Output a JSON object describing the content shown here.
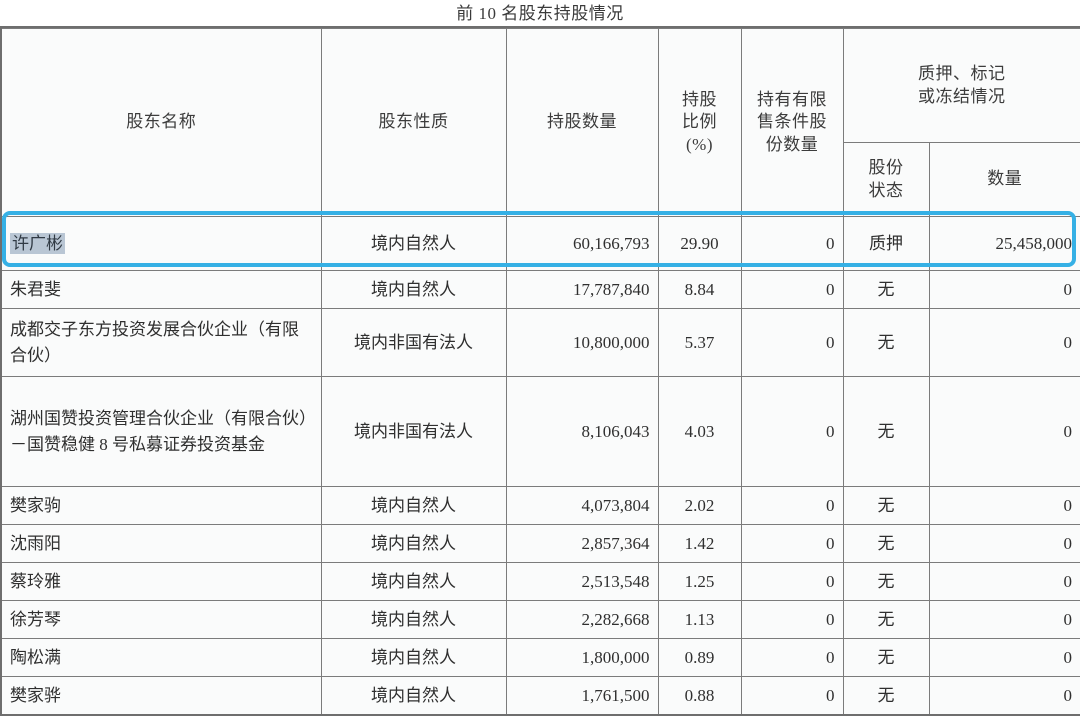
{
  "document": {
    "title": "前 10 名股东持股情况"
  },
  "colors": {
    "highlight_border": "#35b0e5",
    "text_selection_bg": "#b9c6d4",
    "table_border": "#7b7b7b",
    "cell_background": "#fafbfb"
  },
  "table": {
    "headers": {
      "name": "股东名称",
      "nature": "股东性质",
      "shares": "持股数量",
      "ratio": "持股比例（%）",
      "ratio_line1": "持股",
      "ratio_line2": "比例",
      "ratio_line3": "(%)",
      "restricted": "持有有限售条件股份数量",
      "pledge_group": "质押、标记或冻结情况",
      "pledge_group_line1": "质押、标记",
      "pledge_group_line2": "或冻结情况",
      "share_state": "股份状态",
      "share_state_line1": "股份",
      "share_state_line2": "状态",
      "quantity": "数量"
    },
    "rows": [
      {
        "name": "许广彬",
        "nature": "境内自然人",
        "shares": "60,166,793",
        "ratio": "29.90",
        "restricted": "0",
        "state": "质押",
        "quantity": "25,458,000",
        "highlighted": true,
        "selected_text": true
      },
      {
        "name": "朱君斐",
        "nature": "境内自然人",
        "shares": "17,787,840",
        "ratio": "8.84",
        "restricted": "0",
        "state": "无",
        "quantity": "0",
        "highlighted": false,
        "selected_text": false
      },
      {
        "name": "成都交子东方投资发展合伙企业（有限合伙）",
        "nature": "境内非国有法人",
        "shares": "10,800,000",
        "ratio": "5.37",
        "restricted": "0",
        "state": "无",
        "quantity": "0",
        "highlighted": false,
        "selected_text": false
      },
      {
        "name": "湖州国赞投资管理合伙企业（有限合伙）－国赞稳健 8 号私募证券投资基金",
        "nature": "境内非国有法人",
        "shares": "8,106,043",
        "ratio": "4.03",
        "restricted": "0",
        "state": "无",
        "quantity": "0",
        "highlighted": false,
        "selected_text": false
      },
      {
        "name": "樊家驹",
        "nature": "境内自然人",
        "shares": "4,073,804",
        "ratio": "2.02",
        "restricted": "0",
        "state": "无",
        "quantity": "0",
        "highlighted": false,
        "selected_text": false
      },
      {
        "name": "沈雨阳",
        "nature": "境内自然人",
        "shares": "2,857,364",
        "ratio": "1.42",
        "restricted": "0",
        "state": "无",
        "quantity": "0",
        "highlighted": false,
        "selected_text": false
      },
      {
        "name": "蔡玲雅",
        "nature": "境内自然人",
        "shares": "2,513,548",
        "ratio": "1.25",
        "restricted": "0",
        "state": "无",
        "quantity": "0",
        "highlighted": false,
        "selected_text": false
      },
      {
        "name": "徐芳琴",
        "nature": "境内自然人",
        "shares": "2,282,668",
        "ratio": "1.13",
        "restricted": "0",
        "state": "无",
        "quantity": "0",
        "highlighted": false,
        "selected_text": false
      },
      {
        "name": "陶松满",
        "nature": "境内自然人",
        "shares": "1,800,000",
        "ratio": "0.89",
        "restricted": "0",
        "state": "无",
        "quantity": "0",
        "highlighted": false,
        "selected_text": false
      },
      {
        "name": "樊家骅",
        "nature": "境内自然人",
        "shares": "1,761,500",
        "ratio": "0.88",
        "restricted": "0",
        "state": "无",
        "quantity": "0",
        "highlighted": false,
        "selected_text": false
      }
    ]
  }
}
